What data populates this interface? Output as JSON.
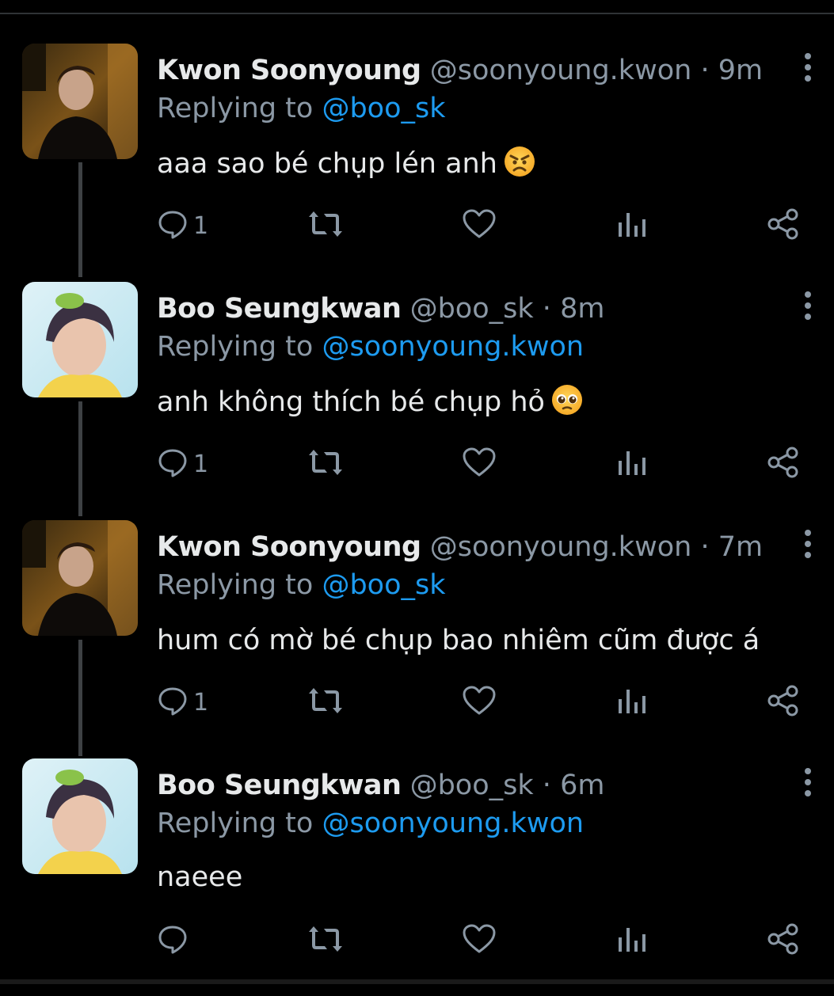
{
  "colors": {
    "background": "#000000",
    "text": "#e7e9ea",
    "muted": "#8b98a5",
    "mention": "#1d9bf0",
    "thread_line": "#3e4144"
  },
  "replying_prefix": "Replying to",
  "tweets": [
    {
      "name": "Kwon Soonyoung",
      "handle": "@soonyoung.kwon",
      "sep": "·",
      "time": "9m",
      "reply_to": "@boo_sk",
      "text": "aaa sao bé chụp lén anh",
      "emoji": "angry-face-icon",
      "reply_count": "1"
    },
    {
      "name": "Boo Seungkwan",
      "handle": "@boo_sk",
      "sep": "·",
      "time": "8m",
      "reply_to": "@soonyoung.kwon",
      "text": "anh không thích bé chụp hỏ",
      "emoji": "pleading-face-icon",
      "reply_count": "1"
    },
    {
      "name": "Kwon Soonyoung",
      "handle": "@soonyoung.kwon",
      "sep": "·",
      "time": "7m",
      "reply_to": "@boo_sk",
      "text": "hum có mờ bé chụp bao nhiêm cũm được á",
      "emoji": "",
      "reply_count": "1"
    },
    {
      "name": "Boo Seungkwan",
      "handle": "@boo_sk",
      "sep": "·",
      "time": "6m",
      "reply_to": "@soonyoung.kwon",
      "text": "naeee",
      "emoji": "",
      "reply_count": ""
    }
  ]
}
